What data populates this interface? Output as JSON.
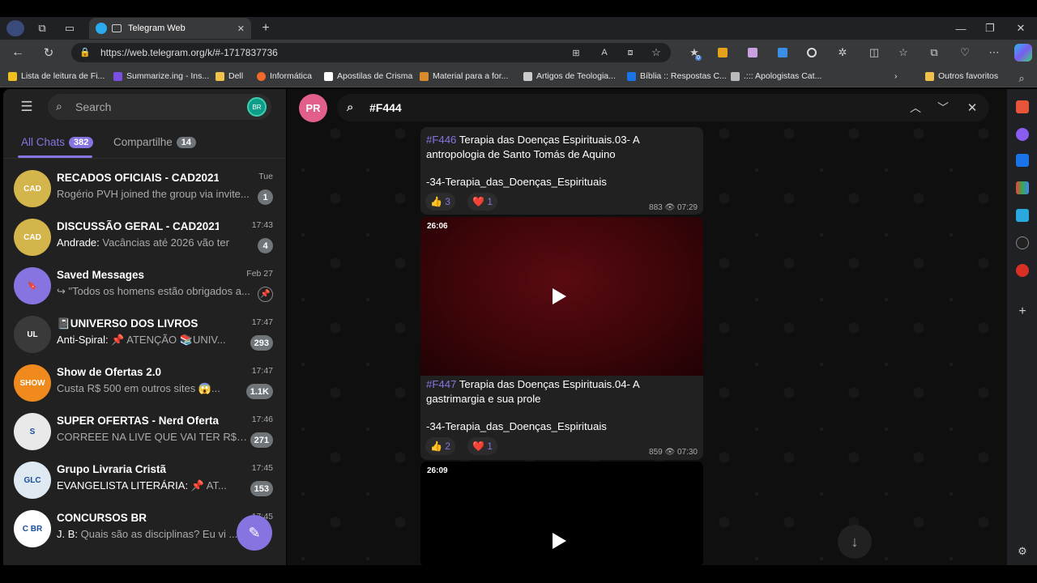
{
  "browser": {
    "tab_title": "Telegram Web",
    "url": "https://web.telegram.org/k/#-1717837736",
    "bookmarks": [
      "Lista de leitura de Fi...",
      "Summarize.ing - Ins...",
      "Dell",
      "Informática",
      "Apostilas de Crisma",
      "Material para a for...",
      "Artigos de Teologia...",
      "Bíblia :: Respostas C...",
      ".::: Apologistas Cat...",
      "Outros favoritos"
    ],
    "ext_badge": "0"
  },
  "sidebar": {
    "search_placeholder": "Search",
    "avatar_initials": "BR",
    "folders": [
      {
        "label": "All Chats",
        "count": "382"
      },
      {
        "label": "Compartilhe",
        "count": "14"
      }
    ],
    "chats": [
      {
        "title": "RECADOS OFICIAIS - CAD2021",
        "time": "Tue",
        "sender": "",
        "preview": "Rogério PVH joined the group via invite...",
        "badge": "1",
        "avatar_color": "#d4b54b",
        "avatar_text": "CAD"
      },
      {
        "title": "DISCUSSÃO GERAL - CAD2021",
        "time": "17:43",
        "sender": "Andrade:",
        "preview": " Vacâncias até 2026 vão ter",
        "badge": "4",
        "avatar_color": "#d4b54b",
        "avatar_text": "CAD"
      },
      {
        "title": "Saved Messages",
        "time": "Feb 27",
        "sender": "",
        "preview": "↪ \"Todos os homens estão obrigados a...",
        "badge": "",
        "avatar_color": "#8774e1",
        "avatar_text": "🔖"
      },
      {
        "title": "📓UNIVERSO DOS LIVROS",
        "time": "17:47",
        "sender": "Anti-Spiral:",
        "preview": " 📌 ATENÇÃO 📚UNIV...",
        "badge": "293",
        "avatar_color": "#3a3a3a",
        "avatar_text": "UL"
      },
      {
        "title": "Show de Ofertas 2.0",
        "time": "17:47",
        "sender": "",
        "preview": "Custa R$ 500 em outros sites 😱...",
        "badge": "1.1K",
        "avatar_color": "#f08a1c",
        "avatar_text": "SHOW"
      },
      {
        "title": "SUPER OFERTAS - Nerd Ofertas",
        "time": "17:46",
        "sender": "",
        "preview": "CORREEE NA LIVE QUE VAI TER R$5...",
        "badge": "271",
        "avatar_color": "#e9e9e9",
        "avatar_text": "S"
      },
      {
        "title": "Grupo Livraria Cristã",
        "time": "17:45",
        "sender": "EVANGELISTA LITERÁRIA:",
        "preview": " 📌 AT...",
        "badge": "153",
        "avatar_color": "#dfe9f2",
        "avatar_text": "GLC"
      },
      {
        "title": "CONCURSOS BR",
        "time": "17:45",
        "sender": "J. B:",
        "preview": " Quais são as disciplinas? Eu vi ...",
        "badge": "",
        "avatar_color": "#ffffff",
        "avatar_text": "C BR"
      }
    ]
  },
  "chat": {
    "header_initials": "PR",
    "search_query": "#F444",
    "messages": [
      {
        "tag": "#F446",
        "title": " Terapia das Doenças Espirituais.03- A antropologia de Santo Tomás de Aquino",
        "file": "-34-Terapia_das_Doenças_Espirituais",
        "likes": "3",
        "hearts": "1",
        "views": "883",
        "time": "07:29"
      },
      {
        "duration": "26:06",
        "tag": "#F447",
        "title": " Terapia das Doenças Espirituais.04- A gastrimargia e sua prole",
        "file": "-34-Terapia_das_Doenças_Espirituais",
        "likes": "2",
        "hearts": "1",
        "views": "859",
        "time": "07:30"
      },
      {
        "duration": "26:09"
      }
    ]
  }
}
